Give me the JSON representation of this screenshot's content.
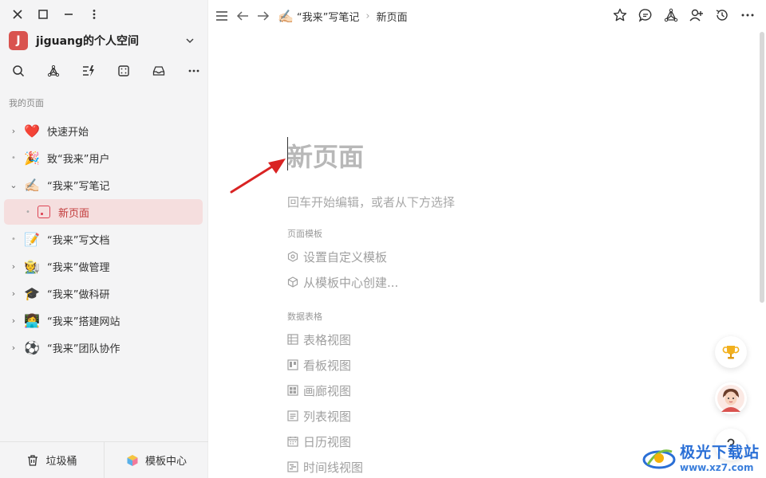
{
  "sidebar": {
    "workspace": {
      "avatar_letter": "J",
      "name": "jiguang的个人空间"
    },
    "section_label": "我的页面",
    "items": [
      {
        "label": "快速开始",
        "emoji": "❤️",
        "state": "collapsed"
      },
      {
        "label": "致“我来”用户",
        "emoji": "🎉",
        "state": "leaf"
      },
      {
        "label": "“我来”写笔记",
        "emoji": "✍🏻",
        "state": "expanded"
      },
      {
        "label": "新页面",
        "state": "active-child"
      },
      {
        "label": "“我来”写文档",
        "emoji": "📝",
        "state": "leaf"
      },
      {
        "label": "“我来”做管理",
        "emoji": "🧑‍🌾",
        "state": "collapsed"
      },
      {
        "label": "“我来”做科研",
        "emoji": "🎓",
        "state": "collapsed"
      },
      {
        "label": "“我来”搭建网站",
        "emoji": "👩‍💻",
        "state": "collapsed"
      },
      {
        "label": "“我来”团队协作",
        "emoji": "⚽",
        "state": "collapsed"
      }
    ],
    "footer": {
      "trash_label": "垃圾桶",
      "templates_label": "模板中心"
    }
  },
  "topbar": {
    "breadcrumb_parent": "“我来”写笔记",
    "breadcrumb_parent_emoji": "✍🏻",
    "breadcrumb_current": "新页面"
  },
  "main": {
    "title_placeholder": "新页面",
    "hint": "回车开始编辑，或者从下方选择",
    "template_group": "页面模板",
    "template_options": [
      "设置自定义模板",
      "从模板中心创建..."
    ],
    "table_group": "数据表格",
    "table_options": [
      "表格视图",
      "看板视图",
      "画廊视图",
      "列表视图",
      "日历视图",
      "时间线视图"
    ]
  },
  "watermark": {
    "text": "极光下载站",
    "url": "www.xz7.com"
  },
  "colors": {
    "accent": "#d9534f",
    "active_bg": "#f5dede",
    "arrow": "#d92323",
    "watermark": "#2a6fd6"
  }
}
